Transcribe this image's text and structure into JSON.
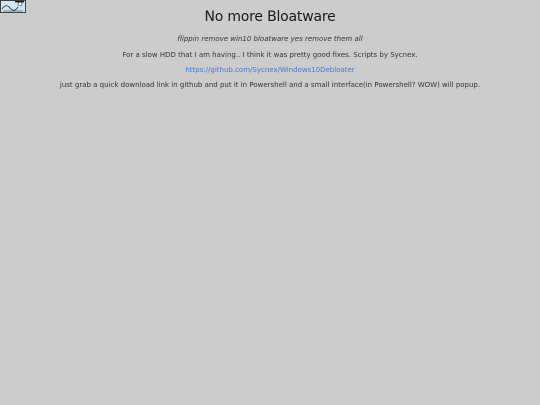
{
  "logo": {
    "icon": "cyberspace-logo-icon",
    "colors": {
      "fill": "#cfe8f5",
      "stroke": "#1a1a1a"
    }
  },
  "post": {
    "title": "No more Bloatware",
    "subtitle": "flippin remove win10 bloatware yes remove them all",
    "paragraph1": "For a slow HDD that I am having.. I think it was pretty good fixes. Scripts by Sycnex.",
    "link_text": "https://github.com/Sycnex/Windows10Debloater",
    "paragraph3": "just grab a quick download link in github and put it in Powershell and a small interface(in Powershell? WOW) will popup."
  },
  "colors": {
    "background": "#cccccc",
    "link": "#3a7bd5",
    "text": "#333333"
  }
}
